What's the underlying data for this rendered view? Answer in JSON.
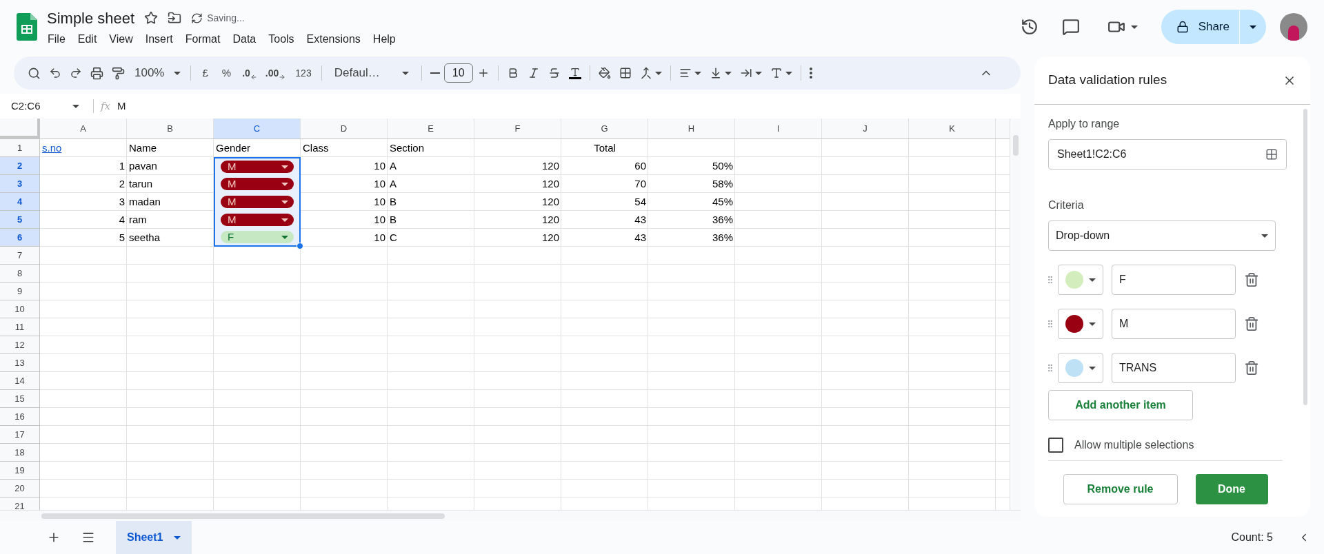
{
  "document": {
    "title": "Simple sheet",
    "status": "Saving..."
  },
  "menu": [
    "File",
    "Edit",
    "View",
    "Insert",
    "Format",
    "Data",
    "Tools",
    "Extensions",
    "Help"
  ],
  "share": {
    "label": "Share"
  },
  "toolbar": {
    "zoom": "100%",
    "currency": "£",
    "percent": "%",
    "decrease_decimals": ".0",
    "increase_decimals": ".00",
    "number_format": "123",
    "font": "Defaul…",
    "font_size": "10"
  },
  "formula_bar": {
    "name_box": "C2:C6",
    "fx_label": "fx",
    "formula": "M"
  },
  "columns": [
    {
      "label": "A",
      "selected": false
    },
    {
      "label": "B",
      "selected": false
    },
    {
      "label": "C",
      "selected": true
    },
    {
      "label": "D",
      "selected": false
    },
    {
      "label": "E",
      "selected": false
    },
    {
      "label": "F",
      "selected": false
    },
    {
      "label": "G",
      "selected": false
    },
    {
      "label": "H",
      "selected": false
    },
    {
      "label": "I",
      "selected": false
    },
    {
      "label": "J",
      "selected": false
    },
    {
      "label": "K",
      "selected": false
    }
  ],
  "rows": [
    {
      "header": "1",
      "selected": false,
      "cells": [
        {
          "kind": "link",
          "text": "s.no"
        },
        {
          "kind": "text",
          "text": "Name"
        },
        {
          "kind": "text",
          "text": "Gender"
        },
        {
          "kind": "text",
          "text": "Class"
        },
        {
          "kind": "text",
          "text": "Section"
        },
        {
          "kind": "merged",
          "text": "Total"
        }
      ]
    },
    {
      "header": "2",
      "selected": true,
      "cells": [
        {
          "kind": "number",
          "text": "1"
        },
        {
          "kind": "text",
          "text": "pavan"
        },
        {
          "kind": "chip",
          "text": "M",
          "color": "#990011"
        },
        {
          "kind": "number",
          "text": "10"
        },
        {
          "kind": "text",
          "text": "A"
        },
        {
          "kind": "number",
          "text": "120"
        },
        {
          "kind": "number",
          "text": "60"
        },
        {
          "kind": "number",
          "text": "50%"
        }
      ]
    },
    {
      "header": "3",
      "selected": true,
      "cells": [
        {
          "kind": "number",
          "text": "2"
        },
        {
          "kind": "text",
          "text": "tarun"
        },
        {
          "kind": "chip",
          "text": "M",
          "color": "#990011"
        },
        {
          "kind": "number",
          "text": "10"
        },
        {
          "kind": "text",
          "text": "A"
        },
        {
          "kind": "number",
          "text": "120"
        },
        {
          "kind": "number",
          "text": "70"
        },
        {
          "kind": "number",
          "text": "58%"
        }
      ]
    },
    {
      "header": "4",
      "selected": true,
      "cells": [
        {
          "kind": "number",
          "text": "3"
        },
        {
          "kind": "text",
          "text": "madan"
        },
        {
          "kind": "chip",
          "text": "M",
          "color": "#990011"
        },
        {
          "kind": "number",
          "text": "10"
        },
        {
          "kind": "text",
          "text": "B"
        },
        {
          "kind": "number",
          "text": "120"
        },
        {
          "kind": "number",
          "text": "54"
        },
        {
          "kind": "number",
          "text": "45%"
        }
      ]
    },
    {
      "header": "5",
      "selected": true,
      "cells": [
        {
          "kind": "number",
          "text": "4"
        },
        {
          "kind": "text",
          "text": "ram"
        },
        {
          "kind": "chip",
          "text": "M",
          "color": "#990011"
        },
        {
          "kind": "number",
          "text": "10"
        },
        {
          "kind": "text",
          "text": "B"
        },
        {
          "kind": "number",
          "text": "120"
        },
        {
          "kind": "number",
          "text": "43"
        },
        {
          "kind": "number",
          "text": "36%"
        }
      ]
    },
    {
      "header": "6",
      "selected": true,
      "cells": [
        {
          "kind": "number",
          "text": "5"
        },
        {
          "kind": "text",
          "text": "seetha"
        },
        {
          "kind": "chip",
          "text": "F",
          "color": "#c6e9c4"
        },
        {
          "kind": "number",
          "text": "10"
        },
        {
          "kind": "text",
          "text": "C"
        },
        {
          "kind": "number",
          "text": "120"
        },
        {
          "kind": "number",
          "text": "43"
        },
        {
          "kind": "number",
          "text": "36%"
        }
      ]
    }
  ],
  "empty_rows": [
    "7",
    "8",
    "9",
    "10",
    "11",
    "12",
    "13",
    "14",
    "15",
    "16",
    "17",
    "18",
    "19",
    "20",
    "21"
  ],
  "sheet_tabs": [
    {
      "label": "Sheet1",
      "selected": true
    }
  ],
  "status_bar": {
    "summary": "Count: 5"
  },
  "panel": {
    "title": "Data validation rules",
    "range_label": "Apply to range",
    "range": "Sheet1!C2:C6",
    "criteria_label": "Criteria",
    "criteria": "Drop-down",
    "items": [
      {
        "value": "F",
        "color": "#d4edbc"
      },
      {
        "value": "M",
        "color": "#990011"
      },
      {
        "value": "TRANS",
        "color": "#bfe1f6"
      }
    ],
    "add_item": "Add another item",
    "multiple": {
      "label": "Allow multiple selections",
      "checked": false
    },
    "remove": "Remove rule",
    "done": "Done"
  }
}
